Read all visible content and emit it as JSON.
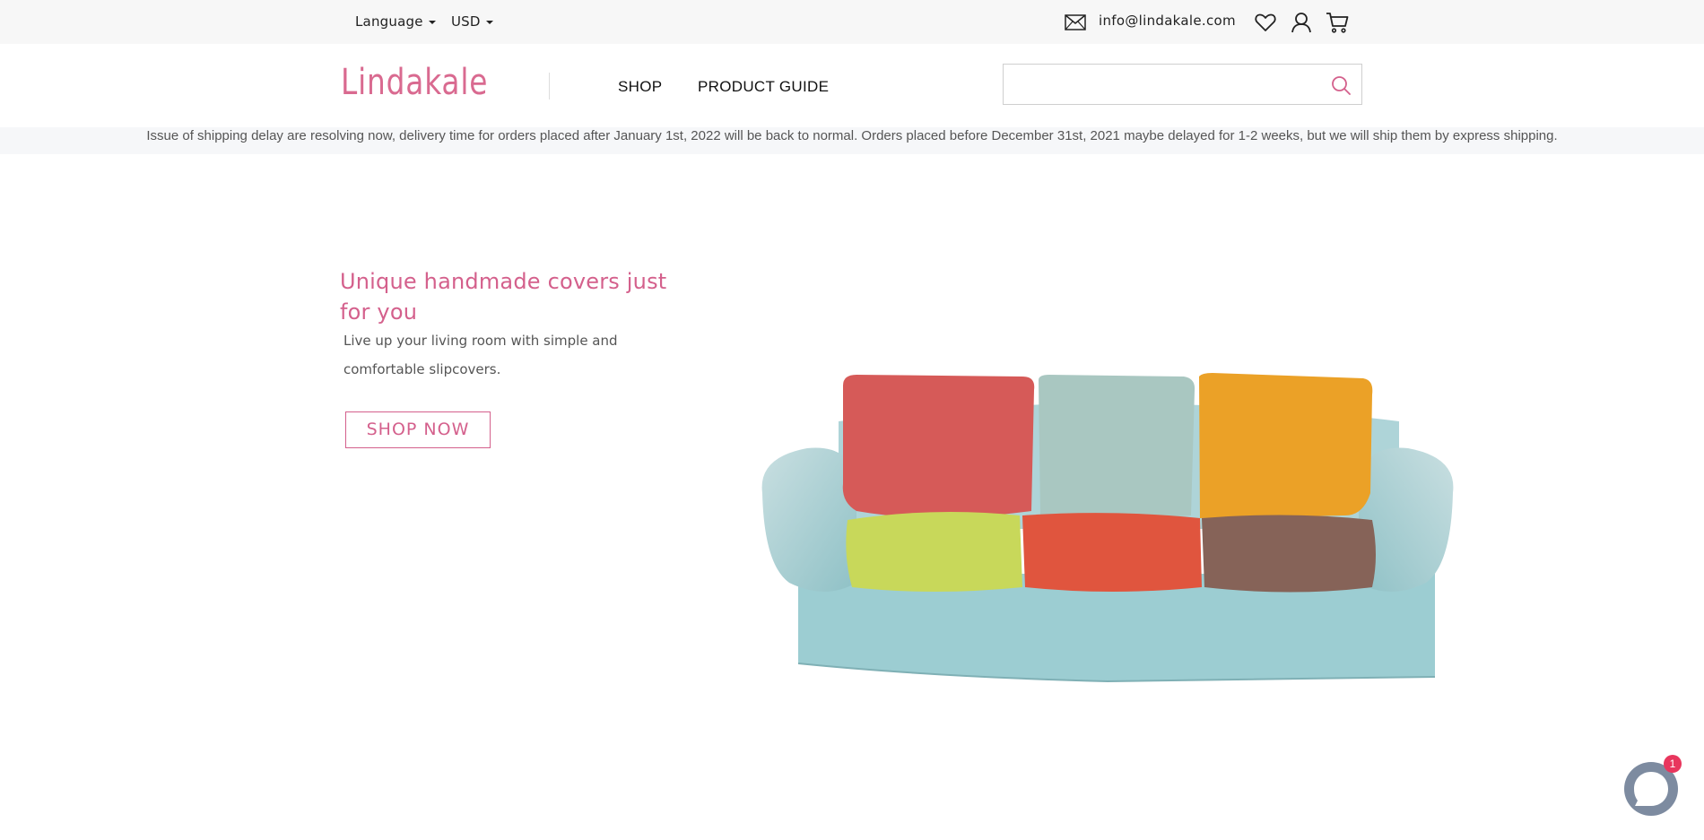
{
  "topbar": {
    "language_label": "Language",
    "currency_label": "USD",
    "email": "info@lindakale.com",
    "icons": [
      "email-icon",
      "heart-icon",
      "user-icon",
      "cart-icon"
    ]
  },
  "header": {
    "logo": "Lindakale",
    "nav": [
      {
        "label": "SHOP"
      },
      {
        "label": "PRODUCT GUIDE"
      }
    ],
    "search": {
      "value": "",
      "placeholder": ""
    }
  },
  "notice": {
    "text": "Issue of shipping delay are resolving now, delivery time for orders placed after January 1st, 2022 will be back to normal. Orders placed before December 31st, 2021 maybe delayed for 1-2 weeks, but we will ship them by express shipping."
  },
  "hero": {
    "title": "Unique handmade covers just for you",
    "subtitle": "Live up your living room with simple and comfortable slipcovers.",
    "cta": "SHOP NOW"
  },
  "chat": {
    "badge_count": "1"
  },
  "colors": {
    "brand_pink": "#d4608c",
    "topbar_bg": "#f7f7f7",
    "notice_bg": "#f6f7f9",
    "chat_ring": "#7d8ba0",
    "badge": "#e8365d"
  }
}
